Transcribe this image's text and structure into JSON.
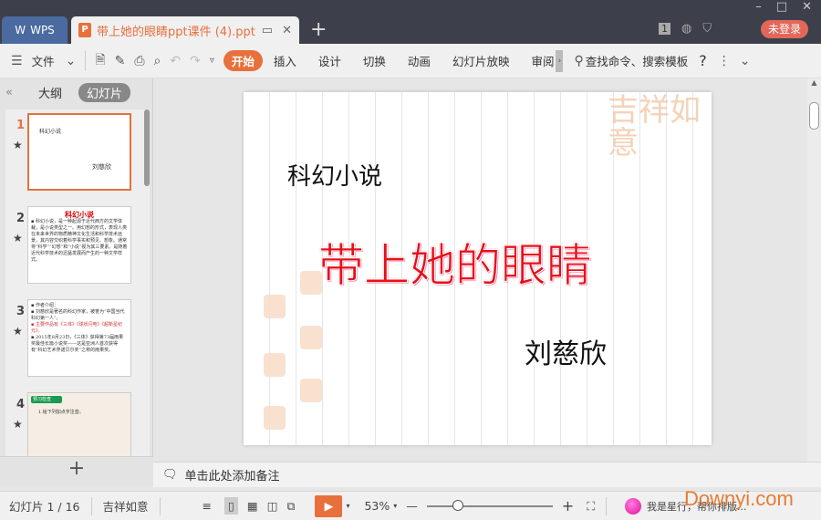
{
  "titlebar": {
    "app_tab": "WPS",
    "doc_tab": "带上她的眼睛ppt课件 (4).ppt",
    "ppt_icon": "P",
    "new_tab": "+",
    "page_badge": "1",
    "login": "未登录",
    "minimize": "–",
    "maximize": "□",
    "close": "✕"
  },
  "toolbar": {
    "menu": "文件",
    "tabs": [
      "开始",
      "插入",
      "设计",
      "切换",
      "动画",
      "幻灯片放映",
      "审阅"
    ],
    "search": "查找命令、搜索模板",
    "help": "?"
  },
  "left_panel": {
    "outline_tab": "大纲",
    "slides_tab": "幻灯片",
    "slides": [
      {
        "num": "1",
        "lines": [
          "科幻小说",
          "刘慈欣"
        ]
      },
      {
        "num": "2",
        "title": "科幻小说",
        "lines": [
          "▪ 科幻小说，是一种起源于近代西方的文学体裁，是小说类型之一。用幻想的形式，表现人类在未来世界的物质精神文化生活和科学技术远景，其内容交织着科学事实和预见、想象。通常将“科学”“幻想”和“小说”视为其三要素。是随着近代科学技术的迅猛发展而产生的一种文学样式。"
        ]
      },
      {
        "num": "3",
        "lines": [
          "▪ 作者介绍：",
          "▪ 刘慈欣是著名的科幻作家，被誉为“中国当代科幻第一人”。",
          "▪ 主要作品有《三体》《球状闪电》《超新星纪元》。",
          "▪ 2015年8月23日，《三体》获得第73届雨果奖最佳长篇小说奖——这是亚洲人首次获得有“科幻艺术界诺贝尔奖”之称的雨果奖。"
        ]
      },
      {
        "num": "4",
        "lines": [
          "预习检查",
          "1.给下列加点字注音。"
        ]
      }
    ]
  },
  "slide": {
    "subtitle": "科幻小说",
    "title": "带上她的眼睛",
    "author": "刘慈欣",
    "decoration": "吉祥如意"
  },
  "notes": {
    "placeholder": "单击此处添加备注"
  },
  "status": {
    "slide_counter": "幻灯片 1 / 16",
    "theme": "吉祥如意",
    "zoom": "53%",
    "zoom_level_percent": 53,
    "assistant": "我是星行，帮你排版..."
  },
  "watermark": "Downyi.com",
  "colors": {
    "accent": "#e8703d",
    "titlebar": "#3d404a",
    "title_red": "#e6101a"
  }
}
